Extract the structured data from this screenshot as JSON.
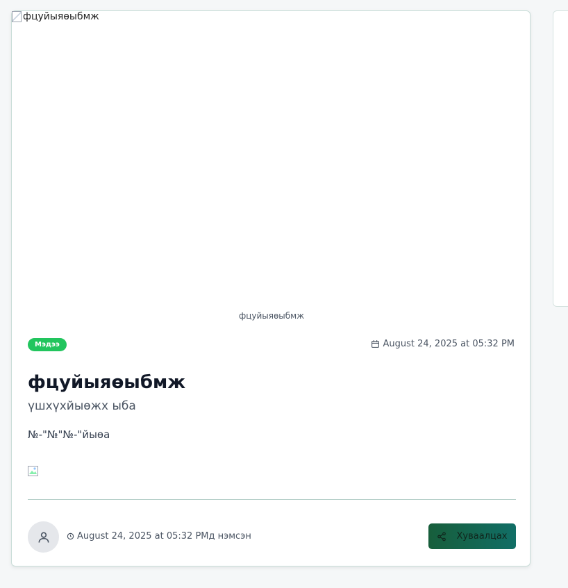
{
  "hero": {
    "alt_text": "фцуйыяөыбмж",
    "caption": "фцуйыяөыбмж"
  },
  "post": {
    "category_badge": "Мэдээ",
    "date": "August 24, 2025 at 05:32 PM",
    "title": "фцуйыяөыбмж",
    "subtitle": "үшхүхйыөжх ыба",
    "body": "№-\"№\"№-\"йыөа"
  },
  "footer": {
    "added_text": "August 24, 2025 at 05:32 PMд нэмсэн",
    "share_label": "Хуваалцах"
  },
  "colors": {
    "badge": "#22c55e",
    "share_button": "#175e3b",
    "card_border": "#c9ddd8"
  },
  "icons": {
    "date": "calendar-icon",
    "avatar": "user-icon",
    "added": "clock-icon",
    "share": "share-icon"
  }
}
